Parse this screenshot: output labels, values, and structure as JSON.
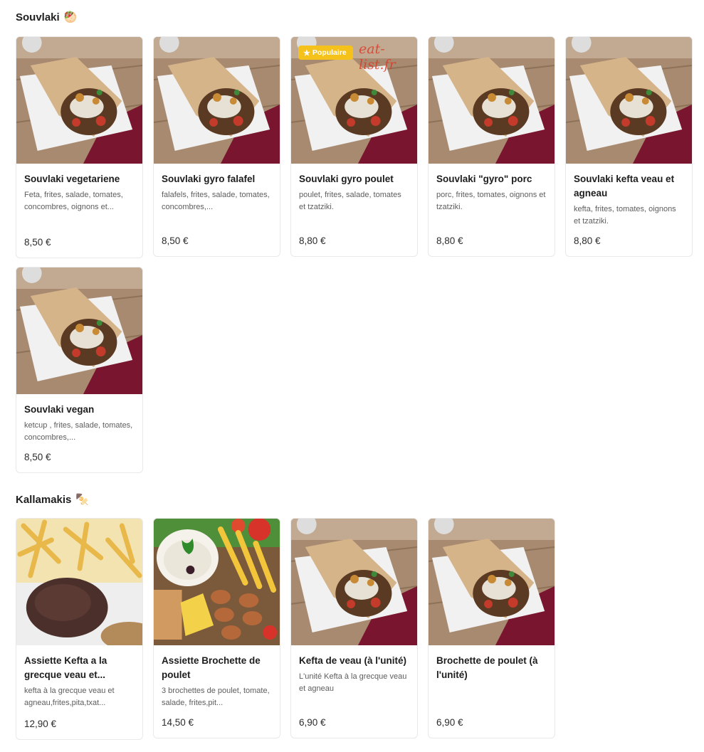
{
  "sections": [
    {
      "title": "Souvlaki",
      "emoji": "🥙",
      "items": [
        {
          "name": "Souvlaki vegetariene",
          "desc": "Feta, frites, salade, tomates, concombres, oignons et...",
          "price": "8,50 €"
        },
        {
          "name": "Souvlaki gyro falafel",
          "desc": "falafels, frites, salade, tomates, concombres,...",
          "price": "8,50 €"
        },
        {
          "name": "Souvlaki gyro poulet",
          "desc": "poulet, frites, salade, tomates et tzatziki.",
          "price": "8,80 €",
          "badge": "Populaire",
          "watermark": "eat-list.fr"
        },
        {
          "name": "Souvlaki \"gyro\" porc",
          "desc": "porc, frites, tomates, oignons et tzatziki.",
          "price": "8,80 €"
        },
        {
          "name": "Souvlaki kefta veau et agneau",
          "desc": "kefta, frites, tomates, oignons et tzatziki.",
          "price": "8,80 €"
        },
        {
          "name": "Souvlaki vegan",
          "desc": "ketcup , frites, salade, tomates, concombres,...",
          "price": "8,50 €"
        }
      ]
    },
    {
      "title": "Kallamakis",
      "emoji": "🍢",
      "items": [
        {
          "name": "Assiette Kefta a la grecque veau et...",
          "desc": "kefta à la grecque veau et agneau,frites,pita,txat...",
          "price": "12,90 €"
        },
        {
          "name": "Assiette Brochette de poulet",
          "desc": "3 brochettes de poulet, tomate, salade, frites,pit...",
          "price": "14,50 €"
        },
        {
          "name": "Kefta de veau (à l'unité)",
          "desc": "L'unité Kefta à la grecque veau et agneau",
          "price": "6,90 €"
        },
        {
          "name": "Brochette de poulet (à l'unité)",
          "desc": "",
          "price": "6,90 €"
        }
      ]
    }
  ]
}
